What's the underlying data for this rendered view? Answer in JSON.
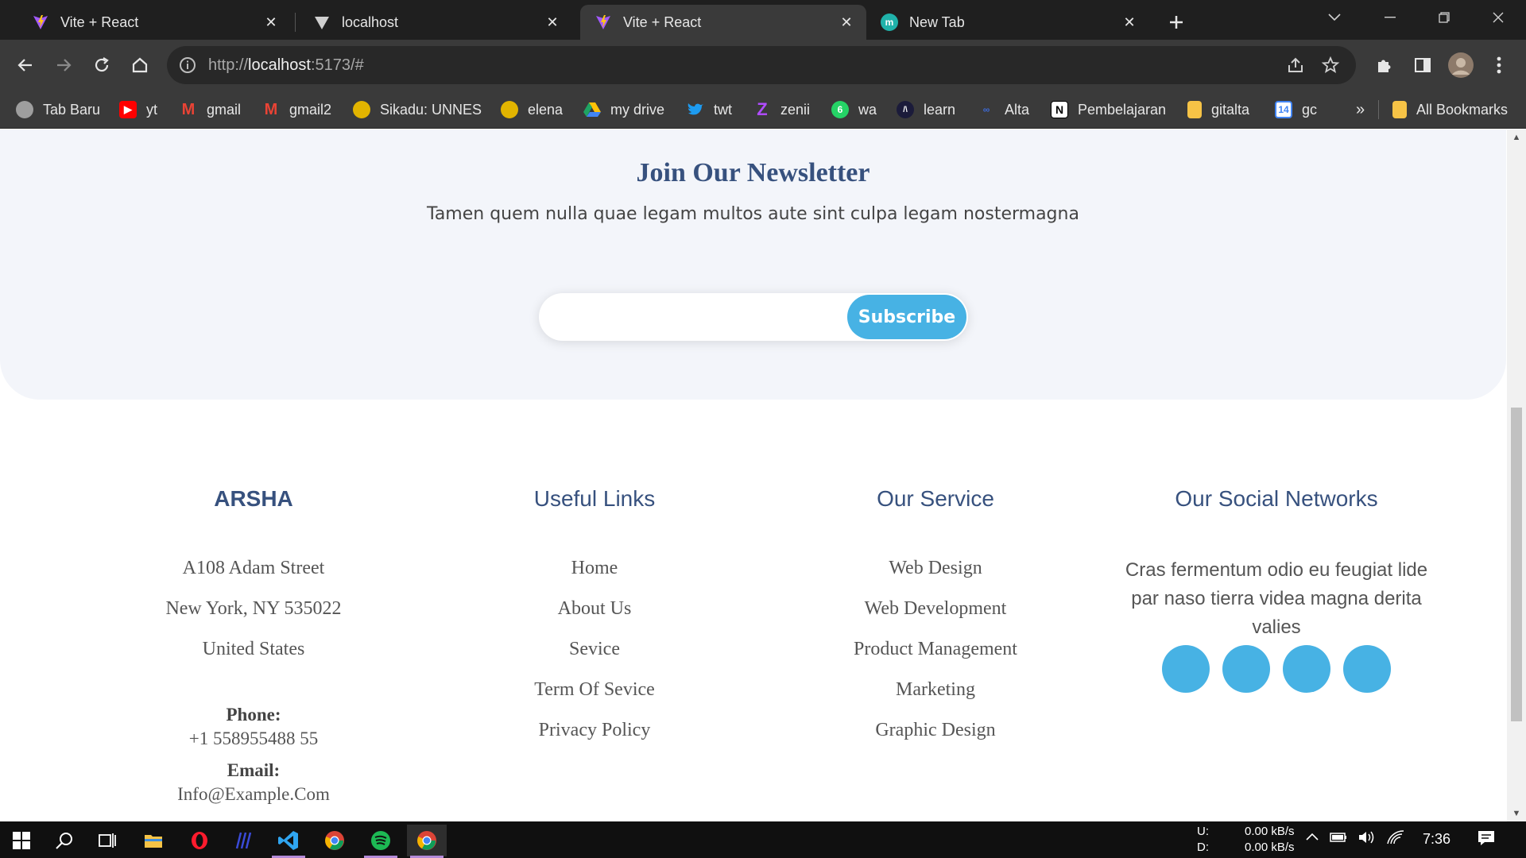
{
  "tabs": [
    {
      "title": "Vite + React",
      "favicon": "vite-icon",
      "active": false
    },
    {
      "title": "localhost",
      "favicon": "vercel-icon",
      "active": false
    },
    {
      "title": "Vite + React",
      "favicon": "vite-icon",
      "active": true
    },
    {
      "title": "New Tab",
      "favicon": "m-icon",
      "active": false
    }
  ],
  "address": {
    "scheme": "http://",
    "host": "localhost",
    "rest": ":5173/#"
  },
  "bookmarks": [
    {
      "label": "Tab Baru",
      "icon": "circle-icon",
      "color": "#9e9e9e"
    },
    {
      "label": "yt",
      "icon": "youtube-icon",
      "color": "#ff0000"
    },
    {
      "label": "gmail",
      "icon": "gmail-icon",
      "color": "#ea4335"
    },
    {
      "label": "gmail2",
      "icon": "gmail-icon",
      "color": "#ea4335"
    },
    {
      "label": "Sikadu: UNNES",
      "icon": "unnes-icon",
      "color": "#e2b400"
    },
    {
      "label": "elena",
      "icon": "unnes-icon",
      "color": "#e2b400"
    },
    {
      "label": "my drive",
      "icon": "drive-icon",
      "color": "#1fa463"
    },
    {
      "label": "twt",
      "icon": "twitter-icon",
      "color": "#1d9bf0"
    },
    {
      "label": "zenii",
      "icon": "z-icon",
      "color": "#8e44ff"
    },
    {
      "label": "wa",
      "icon": "whatsapp-icon",
      "color": "#25d366"
    },
    {
      "label": "learn",
      "icon": "learn-icon",
      "color": "#1b1b3a"
    },
    {
      "label": "Alta",
      "icon": "alta-icon",
      "color": "#3d6ad6"
    },
    {
      "label": "Pembelajaran",
      "icon": "notion-icon",
      "color": "#ffffff"
    },
    {
      "label": "gitalta",
      "icon": "folder-icon",
      "color": "#f6c346"
    },
    {
      "label": "gc",
      "icon": "calendar-icon",
      "color": "#4285f4"
    }
  ],
  "bookmarks_more": "»",
  "all_bookmarks": "All Bookmarks",
  "newsletter": {
    "title": "Join Our Newsletter",
    "text": "Tamen quem nulla quae legam multos aute sint culpa legam nostermagna",
    "input_placeholder": "",
    "button": "Subscribe"
  },
  "footer": {
    "brand": {
      "title": "ARSHA",
      "address": [
        "A108 Adam Street",
        "New York, NY 535022",
        "United States"
      ],
      "phone_label": "Phone:",
      "phone": "+1 558955488 55",
      "email_label": "Email:",
      "email": "Info@Example.Com"
    },
    "useful_links": {
      "title": "Useful Links",
      "items": [
        "Home",
        "About Us",
        "Sevice",
        "Term Of Sevice",
        "Privacy Policy"
      ]
    },
    "services": {
      "title": "Our Service",
      "items": [
        "Web Design",
        "Web Development",
        "Product Management",
        "Marketing",
        "Graphic Design"
      ]
    },
    "social": {
      "title": "Our Social Networks",
      "text": "Cras fermentum odio eu feugiat lide par naso tierra videa magna derita valies",
      "icons": [
        "social-icon-1",
        "social-icon-2",
        "social-icon-3",
        "social-icon-4"
      ]
    }
  },
  "taskbar": {
    "apps": [
      "windows-start-icon",
      "search-icon",
      "task-view-icon",
      "file-explorer-icon",
      "opera-icon",
      "visual-studio-icon",
      "vscode-icon",
      "chrome-icon",
      "spotify-icon",
      "chrome-profile-icon"
    ],
    "net_up_label": "U:",
    "net_down_label": "D:",
    "net_up": "0.00 kB/s",
    "net_down": "0.00 kB/s",
    "time": "7:36"
  },
  "colors": {
    "accent": "#47b2e4",
    "heading": "#37517e",
    "newsletter_bg": "#f3f5fa"
  }
}
